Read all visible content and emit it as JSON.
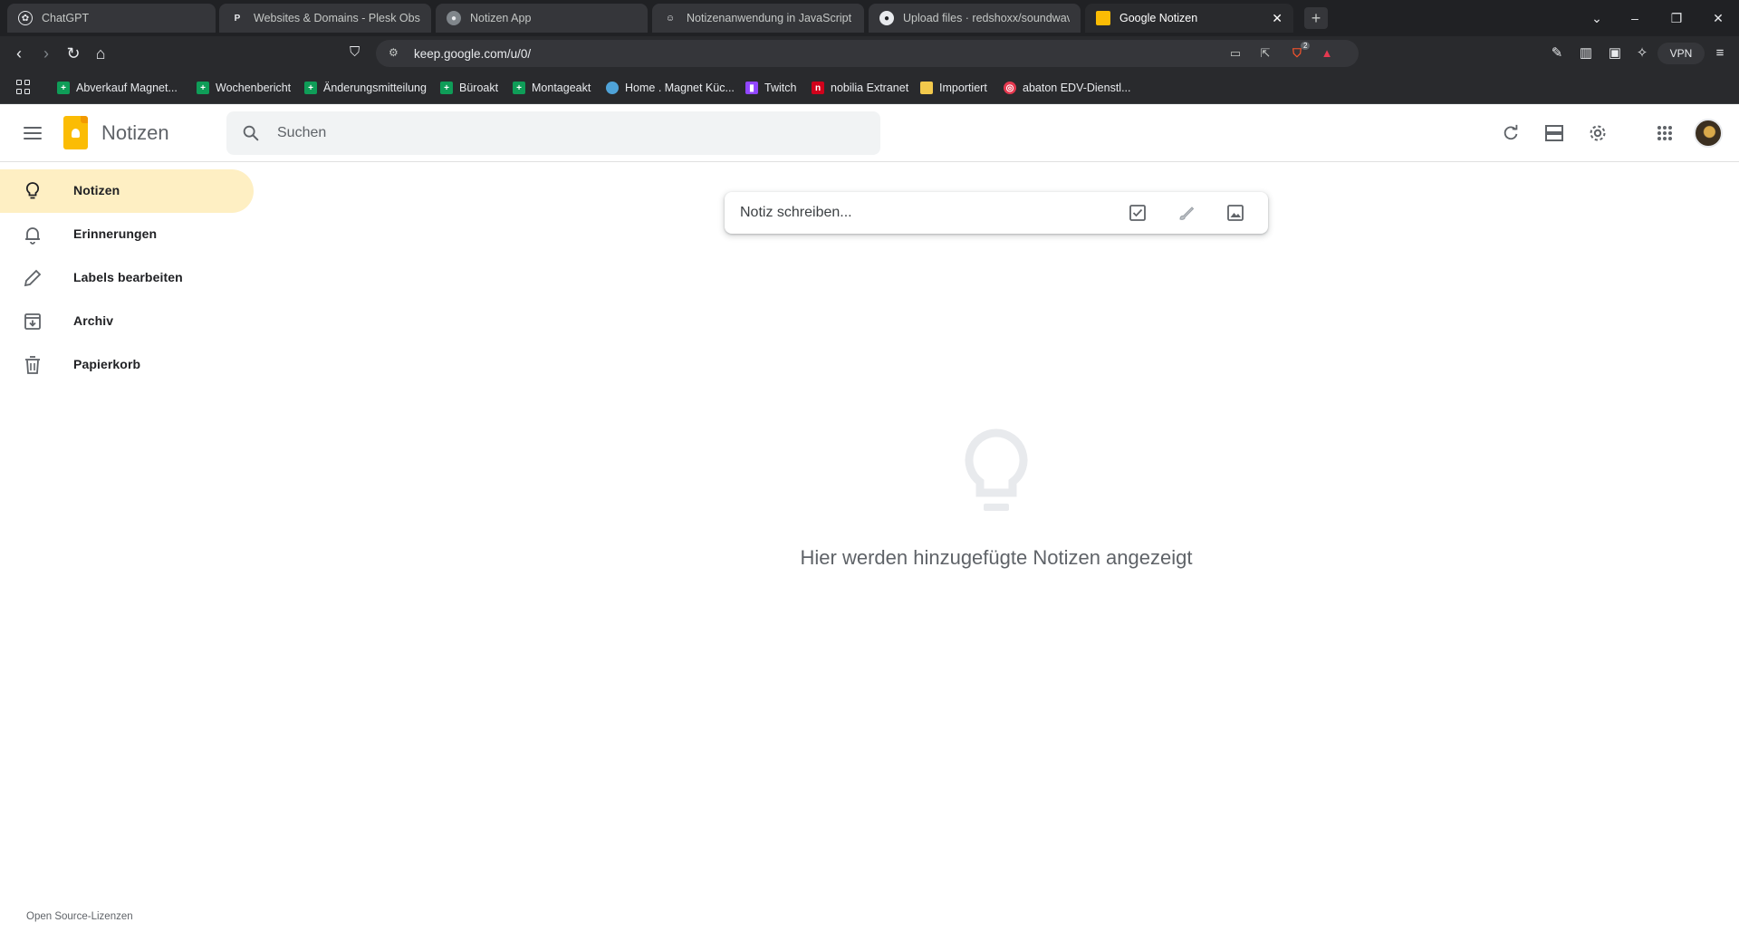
{
  "browser": {
    "tabs": [
      {
        "title": "ChatGPT",
        "icon": "chatgpt-icon"
      },
      {
        "title": "Websites & Domains - Plesk Obsidian",
        "icon": "plesk-icon"
      },
      {
        "title": "Notizen App",
        "icon": "globe-icon"
      },
      {
        "title": "Notizenanwendung in JavaScript erstellen",
        "icon": "copilot-icon"
      },
      {
        "title": "Upload files · redshoxx/soundwave",
        "icon": "github-icon"
      },
      {
        "title": "Google Notizen",
        "icon": "keep-icon"
      }
    ],
    "url": "keep.google.com/u/0/",
    "vpn_label": "VPN",
    "brave_badge": "2",
    "bookmarks": [
      {
        "label": "Abverkauf Magnet...",
        "icon": "sheets-icon",
        "color": "#0f9d58"
      },
      {
        "label": "Wochenbericht",
        "icon": "sheets-icon",
        "color": "#0f9d58"
      },
      {
        "label": "Änderungsmitteilung",
        "icon": "sheets-icon",
        "color": "#0f9d58"
      },
      {
        "label": "Büroakt",
        "icon": "sheets-icon",
        "color": "#0f9d58"
      },
      {
        "label": "Montageakt",
        "icon": "sheets-icon",
        "color": "#0f9d58"
      },
      {
        "label": "Home . Magnet Küc...",
        "icon": "globe-icon",
        "color": "#4fa3d8"
      },
      {
        "label": "Twitch",
        "icon": "twitch-icon",
        "color": "#9146ff"
      },
      {
        "label": "nobilia Extranet",
        "icon": "nobilia-icon",
        "color": "#d0021b"
      },
      {
        "label": "Importiert",
        "icon": "folder-icon",
        "color": "#f2c94c"
      },
      {
        "label": "abaton EDV-Dienstl...",
        "icon": "abaton-icon",
        "color": "#e53950"
      }
    ]
  },
  "app": {
    "title": "Notizen",
    "search_placeholder": "Suchen",
    "sidebar": [
      {
        "label": "Notizen",
        "icon": "lightbulb-icon",
        "active": true
      },
      {
        "label": "Erinnerungen",
        "icon": "bell-icon",
        "active": false
      },
      {
        "label": "Labels bearbeiten",
        "icon": "pencil-icon",
        "active": false
      },
      {
        "label": "Archiv",
        "icon": "archive-icon",
        "active": false
      },
      {
        "label": "Papierkorb",
        "icon": "trash-icon",
        "active": false
      }
    ],
    "note_placeholder": "Notiz schreiben...",
    "empty_message": "Hier werden hinzugefügte Notizen angezeigt",
    "footer_link": "Open Source-Lizenzen",
    "accent_color": "#feefc3",
    "brand_color": "#fbbc04"
  }
}
